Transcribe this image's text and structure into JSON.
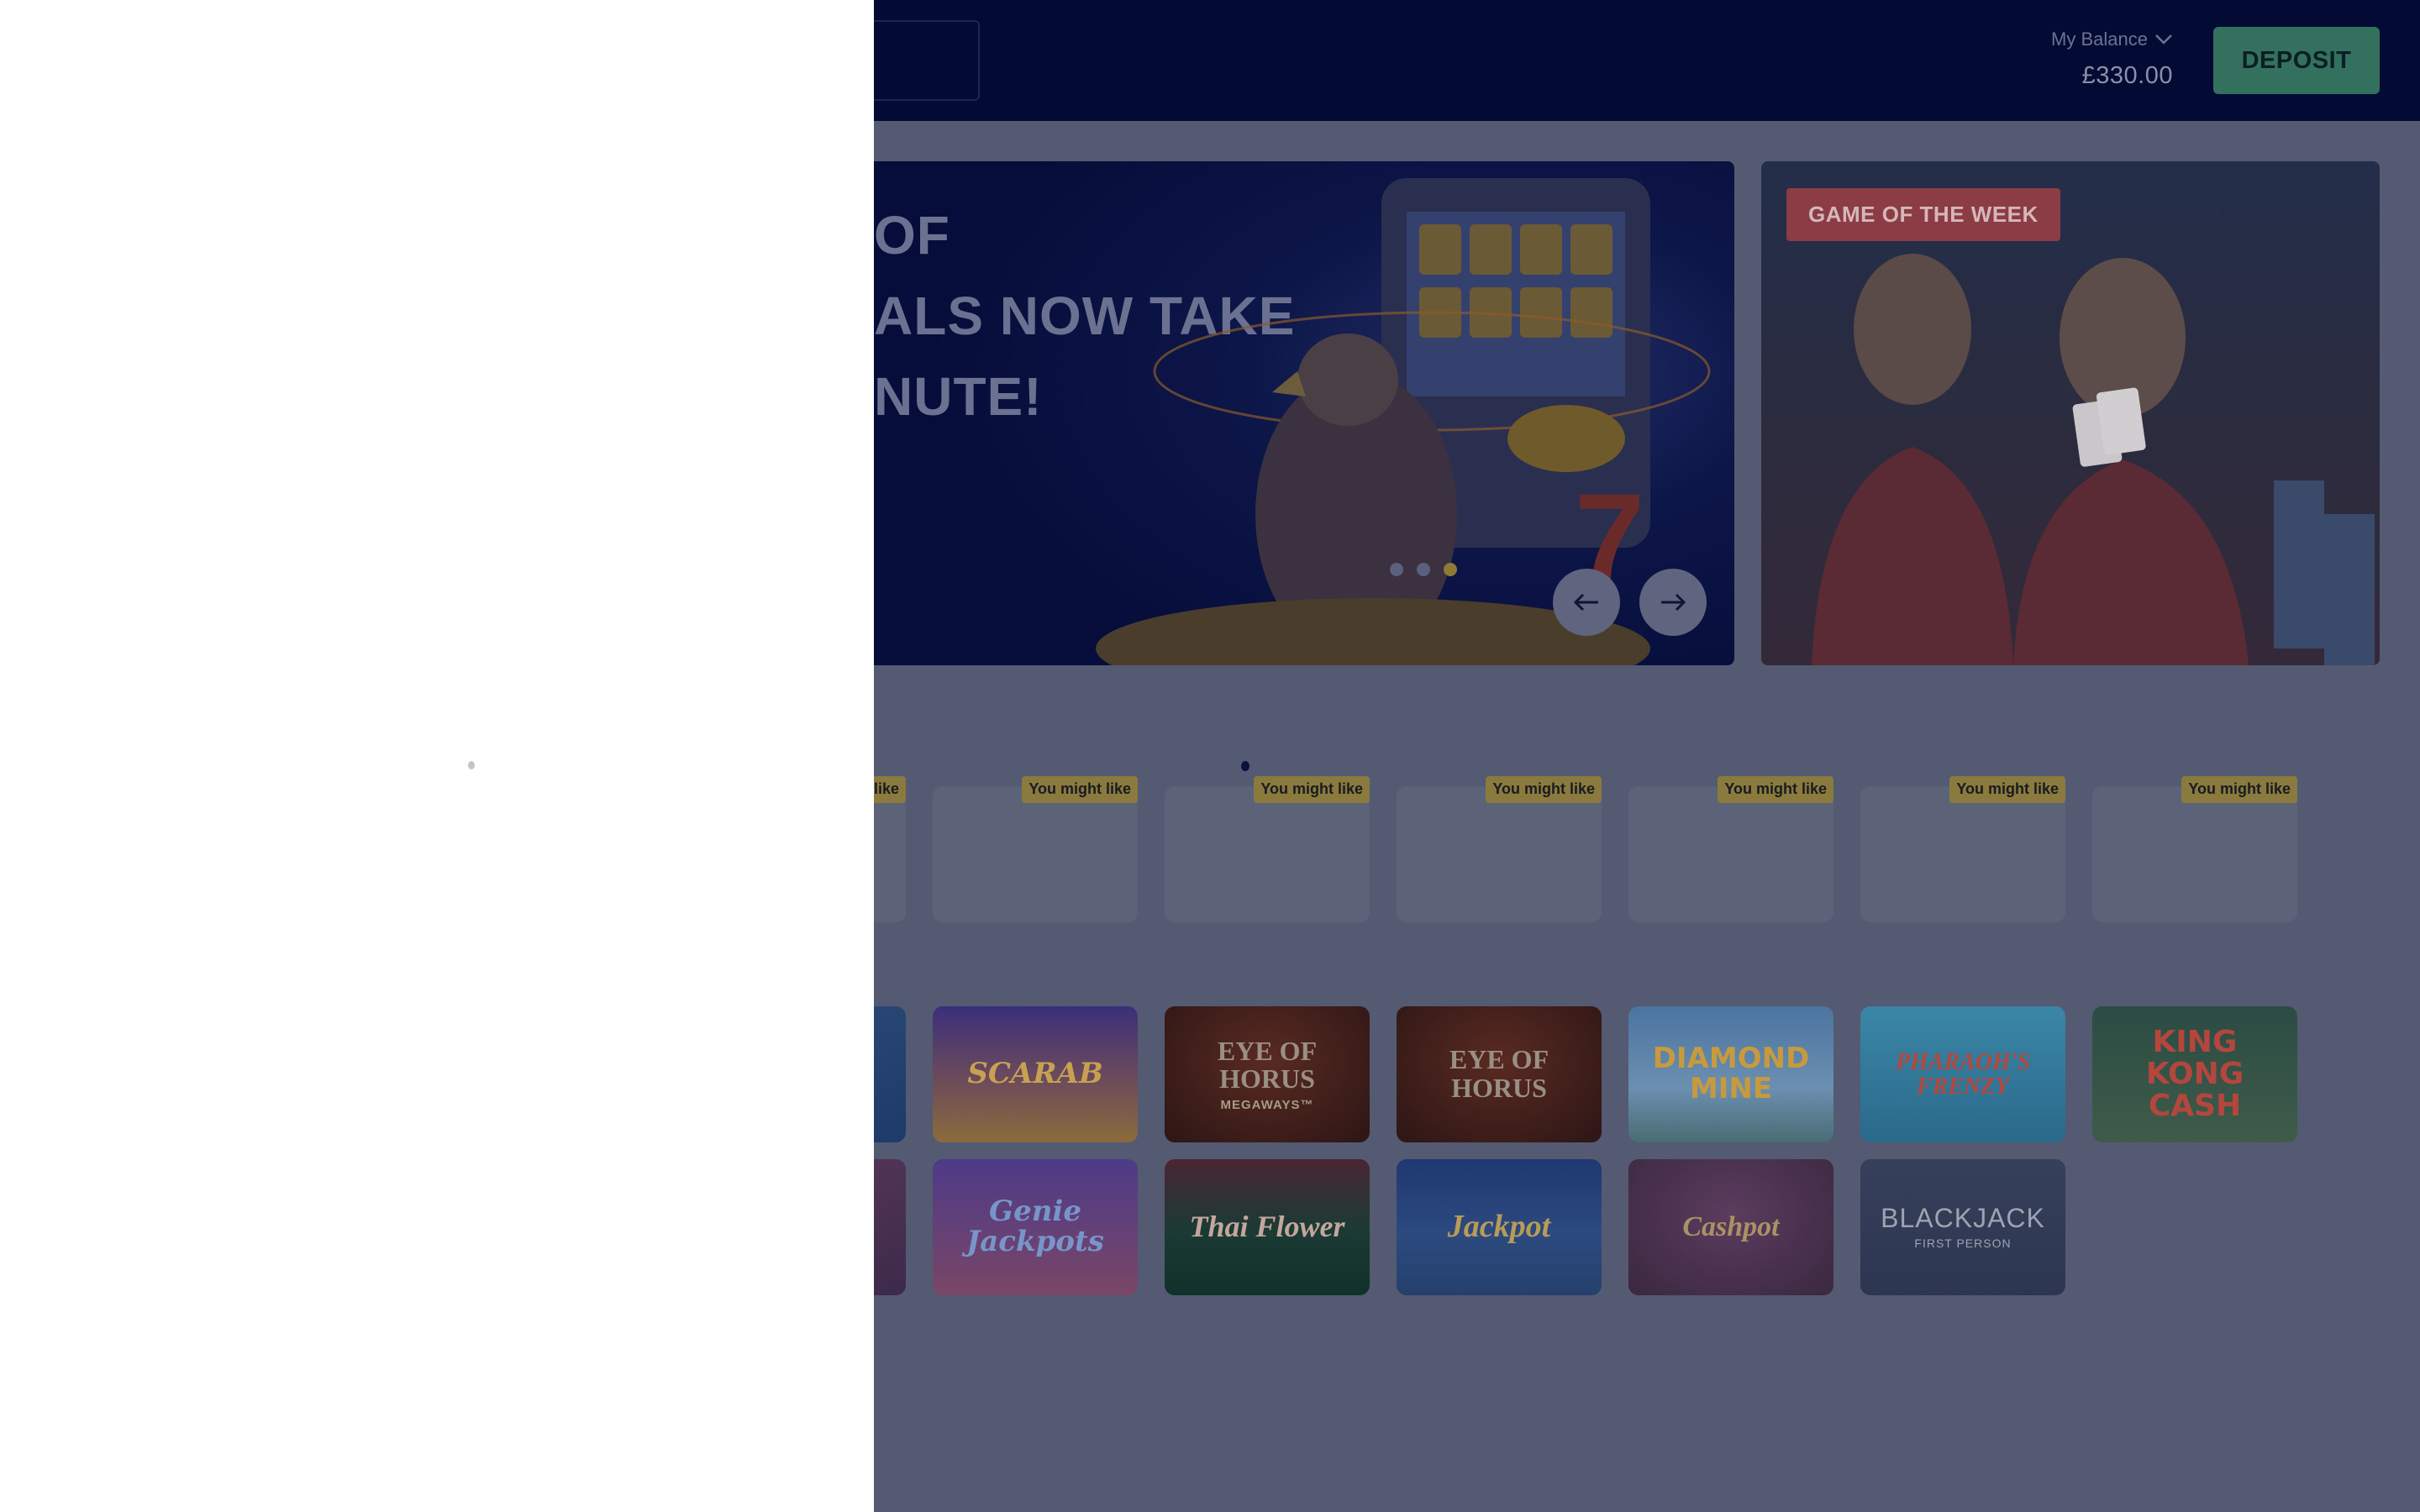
{
  "header": {
    "balance_label": "My Balance",
    "balance_value": "£330.00",
    "deposit_label": "DEPOSIT"
  },
  "hero": {
    "title_lines": [
      "OF",
      "ALS NOW TAKE",
      "NUTE!"
    ],
    "slides_total": 3,
    "active_slide": 3
  },
  "game_of_week": {
    "badge": "GAME OF THE WEEK"
  },
  "recommended": {
    "tag": "You might like",
    "count": 7
  },
  "games": {
    "row1": [
      {
        "name": "",
        "style": "partial-blue"
      },
      {
        "name": "SCARAB",
        "style": "scarab"
      },
      {
        "name": "EYE OF HORUS",
        "sub": "MEGAWAYS™",
        "style": "horus"
      },
      {
        "name": "EYE OF HORUS",
        "style": "horus"
      },
      {
        "name": "DIAMOND MINE",
        "style": "diamond"
      },
      {
        "name": "PHARAOH'S FRENZY",
        "style": "pharaoh"
      },
      {
        "name": "KING KONG CASH",
        "style": "kingkong"
      }
    ],
    "row2": [
      {
        "name": "",
        "style": "partial-pink"
      },
      {
        "name": "Genie Jackpots",
        "style": "genie"
      },
      {
        "name": "Thai Flower",
        "style": "thai"
      },
      {
        "name": "Jackpot",
        "style": "jackpot"
      },
      {
        "name": "Cashpot",
        "style": "cashpot"
      },
      {
        "name": "BLACKJACK",
        "sub": "FIRST PERSON",
        "style": "blackjack"
      }
    ]
  },
  "colors": {
    "header_bg": "#030b34",
    "overlay_bg": "#535a72",
    "deposit_bg": "#34705e",
    "tag_bg": "#8a7a3e",
    "gotw_badge_bg": "#8b3c44",
    "panel_bg": "#ffffff"
  },
  "icons": {
    "balance_toggle": "chevron-down-icon",
    "prev": "arrow-left-icon",
    "next": "arrow-right-icon"
  }
}
